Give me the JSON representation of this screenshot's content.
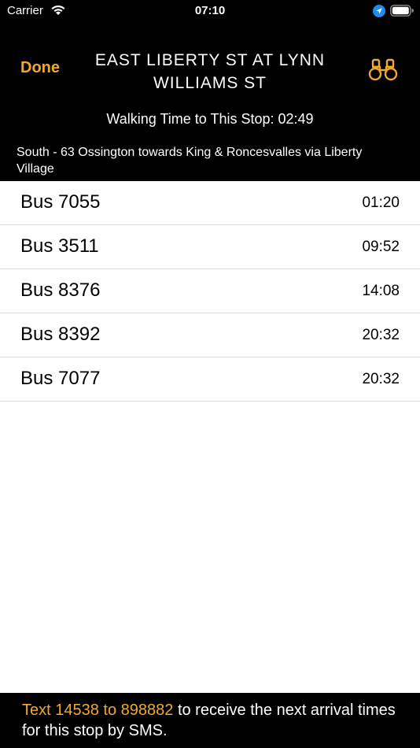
{
  "status_bar": {
    "carrier": "Carrier",
    "time": "07:10",
    "icons": [
      "wifi-icon",
      "location-icon",
      "battery-icon"
    ]
  },
  "header": {
    "done_label": "Done",
    "title": "EAST LIBERTY ST AT LYNN WILLIAMS ST",
    "walking_time": "Walking Time to This Stop: 02:49",
    "route_description": "South - 63 Ossington towards King & Roncesvalles via Liberty Village",
    "right_icon": "binoculars-icon"
  },
  "arrivals": [
    {
      "bus": "Bus 7055",
      "time": "01:20"
    },
    {
      "bus": "Bus 3511",
      "time": "09:52"
    },
    {
      "bus": "Bus 8376",
      "time": "14:08"
    },
    {
      "bus": "Bus 8392",
      "time": "20:32"
    },
    {
      "bus": "Bus 7077",
      "time": "20:32"
    }
  ],
  "footer": {
    "sms_highlight": "Text 14538 to 898882",
    "sms_rest": " to receive the next arrival times for this stop by SMS."
  },
  "colors": {
    "accent": "#f0a92e",
    "header_bg": "#000000",
    "location_blue": "#1e8cf0"
  }
}
